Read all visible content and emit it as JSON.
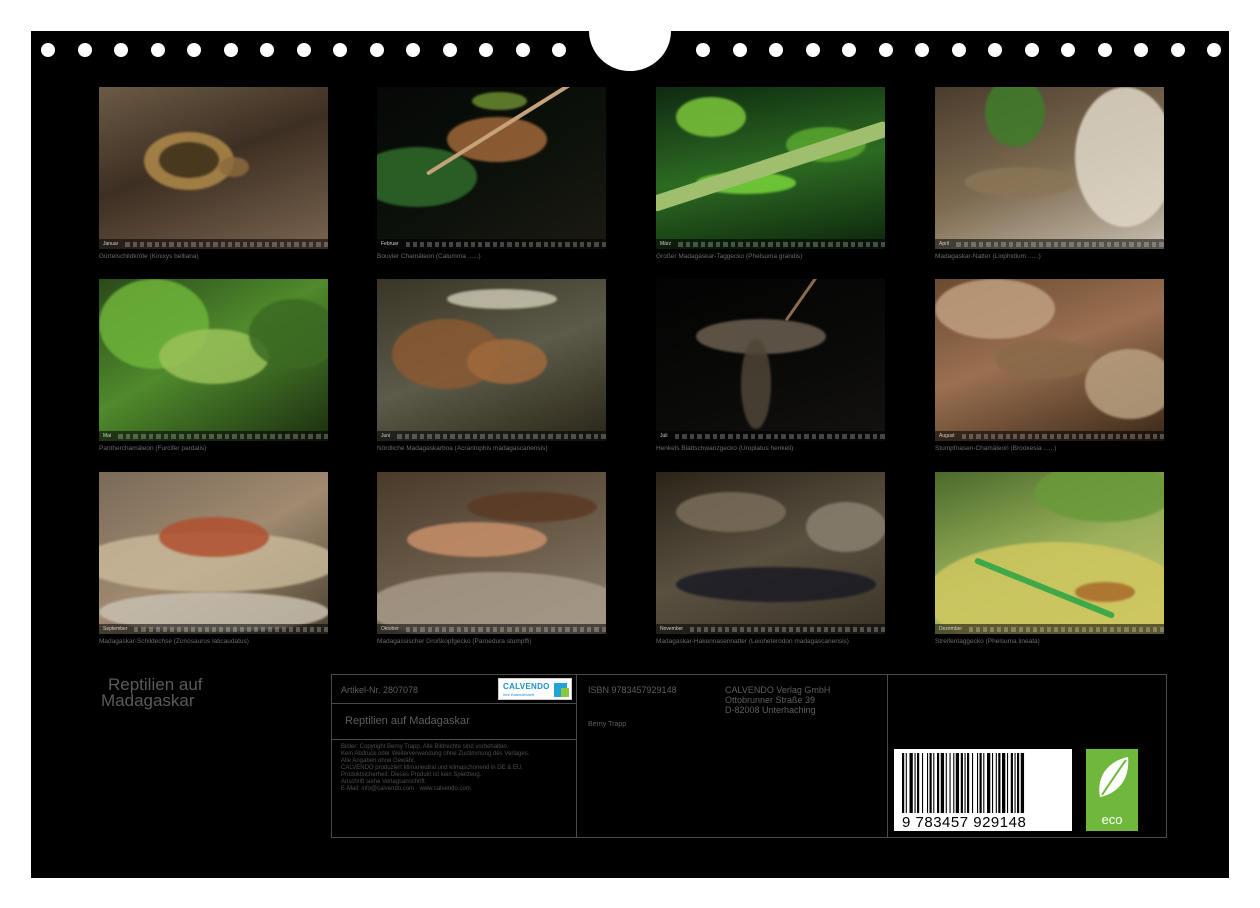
{
  "calendar": {
    "title_line1": "Reptilien auf",
    "title_line2": "Madagaskar",
    "colors": {
      "background": "#000000",
      "border": "#4a4a4a",
      "caption_text": "#6a6a6a"
    }
  },
  "photos": [
    {
      "month": "Januar",
      "caption": "Gürtelschildkröte (Kinixys belliana)"
    },
    {
      "month": "Februar",
      "caption": "Bouvier Chamäleon (Calumma ......)"
    },
    {
      "month": "März",
      "caption": "Großer Madagaskar-Taggecko (Phelsuma grandis)"
    },
    {
      "month": "April",
      "caption": "Madagaskar-Natter (Liophidium ......)"
    },
    {
      "month": "Mai",
      "caption": "Pantherchamäleon (Furcifer pardalis)"
    },
    {
      "month": "Juni",
      "caption": "Nördliche Madagaskarboa (Acrantophis madagascariensis)"
    },
    {
      "month": "Juli",
      "caption": "Henkels Blattschwanzgecko (Uroplatus henkeli)"
    },
    {
      "month": "August",
      "caption": "Stumpfnasen-Chamäleon (Brookesia ......)"
    },
    {
      "month": "September",
      "caption": "Madagaskar-Schildechse (Zonosaurus laticaudatus)"
    },
    {
      "month": "Oktober",
      "caption": "Madagassischer Großkopfgecko (Paroedura stumpffi)"
    },
    {
      "month": "November",
      "caption": "Madagaskar-Hakennasennatter (Leioheterodon madagascariensis)"
    },
    {
      "month": "Dezember",
      "caption": "Streifentaggecko (Phelsuma lineata)"
    }
  ],
  "info": {
    "article": "Artikel-Nr. 2807078",
    "calendar_title": "Reptilien auf Madagaskar",
    "legal": [
      "Bilder: Copyright Berny Trapp. Alle Bildrechte sind vorbehalten.",
      "Kein Abdruck oder Weiterverwendung ohne Zustimmung des Verlages.",
      "Alle Angaben ohne Gewähr.",
      "CALVENDO produziert klimaneutral und klimaschonend in DE & EU.",
      "Produktsicherheit: Dieses Produkt ist kein Spielzeug.",
      "Anschrift siehe Verlagsanschrift.",
      "E-Mail: info@calvendo.com · www.calvendo.com"
    ],
    "isbn": "ISBN 9783457929148",
    "author": "Berny Trapp",
    "publisher_name": "CALVENDO Verlag GmbH",
    "publisher_street": "Ottobrunner Straße 39",
    "publisher_city": "D-82008 Unterhaching",
    "logo_brand": "CALVENDO",
    "logo_tag": "Ihre Kalenderwelt",
    "barcode_digits": "9 783457 929148",
    "eco_label": "eco"
  }
}
